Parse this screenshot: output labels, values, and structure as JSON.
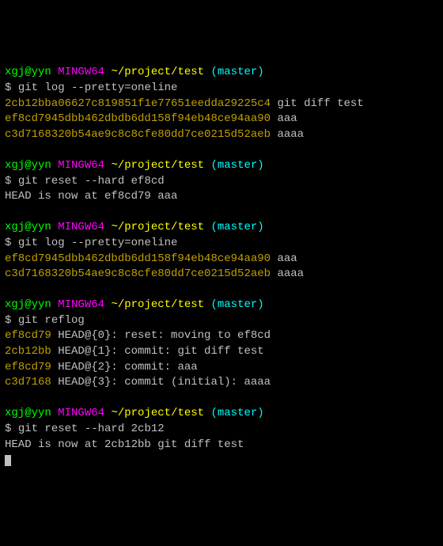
{
  "prompt": {
    "user": "xgj@yyn",
    "shell": "MINGW64",
    "path": "~/project/test",
    "branch": "(master)",
    "symbol": "$"
  },
  "blocks": [
    {
      "command": "git log --pretty=oneline",
      "output": [
        {
          "hash": "2cb12bba06627c819851f1e77651eedda29225c4",
          "msg": "git diff test"
        },
        {
          "hash": "ef8cd7945dbb462dbdb6dd158f94eb48ce94aa90",
          "msg": "aaa"
        },
        {
          "hash": "c3d7168320b54ae9c8c8cfe80dd7ce0215d52aeb",
          "msg": "aaaa"
        }
      ]
    },
    {
      "command": "git reset --hard ef8cd",
      "plain": [
        "HEAD is now at ef8cd79 aaa"
      ]
    },
    {
      "command": "git log --pretty=oneline",
      "output": [
        {
          "hash": "ef8cd7945dbb462dbdb6dd158f94eb48ce94aa90",
          "msg": "aaa"
        },
        {
          "hash": "c3d7168320b54ae9c8c8cfe80dd7ce0215d52aeb",
          "msg": "aaaa"
        }
      ]
    },
    {
      "command": "git reflog",
      "reflog": [
        {
          "short": "ef8cd79",
          "ref": "HEAD@{0}",
          "msg": "reset: moving to ef8cd"
        },
        {
          "short": "2cb12bb",
          "ref": "HEAD@{1}",
          "msg": "commit: git diff test"
        },
        {
          "short": "ef8cd79",
          "ref": "HEAD@{2}",
          "msg": "commit: aaa"
        },
        {
          "short": "c3d7168",
          "ref": "HEAD@{3}",
          "msg": "commit (initial): aaaa"
        }
      ]
    },
    {
      "command": "git reset --hard 2cb12",
      "plain": [
        "HEAD is now at 2cb12bb git diff test"
      ]
    }
  ]
}
